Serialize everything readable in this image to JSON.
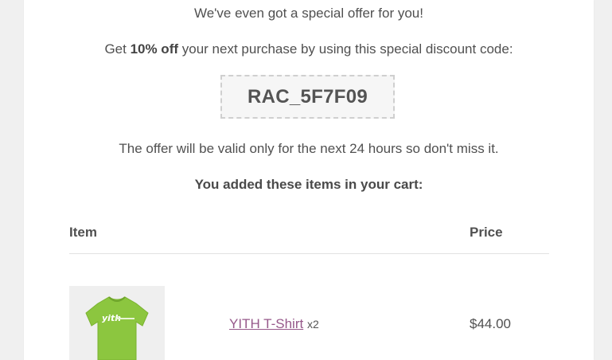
{
  "email": {
    "offer_line": "We've even got a special offer for you!",
    "discount_prefix": "Get ",
    "discount_amount": "10% off",
    "discount_suffix": " your next purchase by using this special discount code:",
    "coupon_code": "RAC_5F7F09",
    "validity_note": "The offer will be valid only for the next 24 hours so don't miss it.",
    "cart_heading": "You added these items in your cart:"
  },
  "cart_table": {
    "headers": {
      "item": "Item",
      "price": "Price"
    },
    "rows": [
      {
        "product_name": "YITH T-Shirt",
        "quantity": "x2",
        "price": "$44.00",
        "thumbnail_icon": "green-tshirt-image",
        "thumbnail_color": "#8cc63f"
      }
    ]
  },
  "colors": {
    "link": "#96588a",
    "text": "#505050",
    "background": "#f0f0f0"
  }
}
